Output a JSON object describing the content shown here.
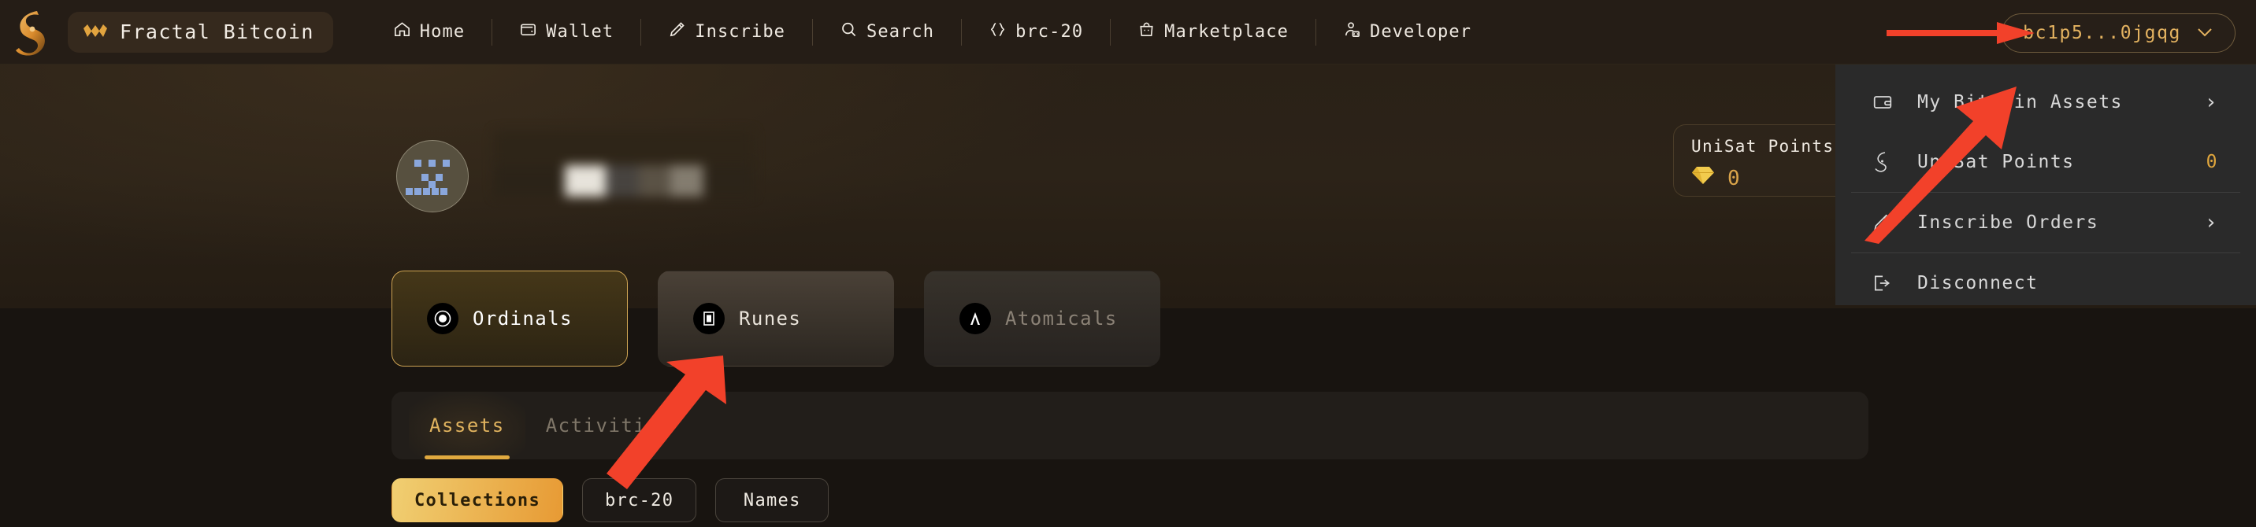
{
  "nav": {
    "brand": "Fractal Bitcoin",
    "items": [
      {
        "label": "Home",
        "icon": "home-icon"
      },
      {
        "label": "Wallet",
        "icon": "wallet-icon"
      },
      {
        "label": "Inscribe",
        "icon": "pencil-icon"
      },
      {
        "label": "Search",
        "icon": "search-icon"
      },
      {
        "label": "brc-20",
        "icon": "braces-icon"
      },
      {
        "label": "Marketplace",
        "icon": "bag-icon"
      },
      {
        "label": "Developer",
        "icon": "developer-icon"
      }
    ],
    "wallet_address": "bc1p5...0jgqg",
    "wallet_chevron": "∨"
  },
  "dropdown": {
    "items": [
      {
        "label": "My Bitcoin Assets",
        "icon": "card-icon",
        "right": "›",
        "right_style": "chevron"
      },
      {
        "label": "UniSat Points",
        "icon": "unisat-logo-icon",
        "right": "0",
        "right_style": "amber"
      },
      {
        "label": "Inscribe Orders",
        "icon": "pencil-icon",
        "right": "›",
        "right_style": "chevron"
      },
      {
        "label": "Disconnect",
        "icon": "logout-icon",
        "right": "",
        "right_style": "none"
      }
    ]
  },
  "profile": {
    "points_card": {
      "title": "UniSat Points",
      "chevron": "›",
      "value": "0",
      "gem_icon": "gem-icon"
    }
  },
  "chain_tabs": [
    {
      "label": "Ordinals",
      "icon": "ordinals-icon",
      "state": "active"
    },
    {
      "label": "Runes",
      "icon": "runes-icon",
      "state": "normal"
    },
    {
      "label": "Atomicals",
      "icon": "atomicals-icon",
      "state": "dim"
    }
  ],
  "panel": {
    "tabs": [
      {
        "label": "Assets",
        "state": "active"
      },
      {
        "label": "Activities",
        "state": "inactive"
      }
    ]
  },
  "filter_pills": [
    {
      "label": "Collections",
      "state": "active"
    },
    {
      "label": "brc-20",
      "state": "normal"
    },
    {
      "label": "Names",
      "state": "normal"
    }
  ],
  "colors": {
    "accent_gold": "#e0a93f",
    "accent_amber": "#e3b260",
    "annotation_red": "#f2412a",
    "nav_bg": "#251d16",
    "page_bg": "#181410"
  }
}
